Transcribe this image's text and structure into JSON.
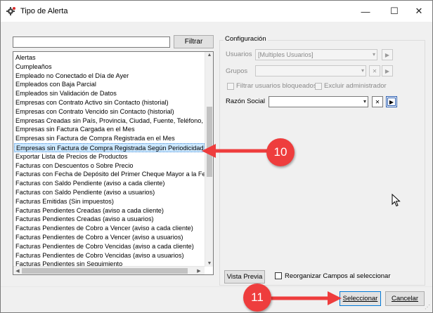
{
  "window": {
    "title": "Tipo de Alerta",
    "minimize_glyph": "—",
    "maximize_glyph": "☐",
    "close_glyph": "✕"
  },
  "filter": {
    "value": "",
    "button_label": "Filtrar"
  },
  "list": {
    "items": [
      "Alertas",
      "Cumpleaños",
      "Empleado no Conectado el Día de Ayer",
      "Empleados con Baja Parcial",
      "Empleados sin Validación de Datos",
      "Empresas con Contrato Activo sin Contacto (historial)",
      "Empresas con Contrato Vencido sin Contacto (historial)",
      "Empresas Creadas sin País, Provincia, Ciudad, Fuente, Teléfono, Tip",
      "Empresas sin Factura Cargada en el Mes",
      "Empresas sin Factura de Compra Registrada en el Mes",
      "Empresas sin Factura de Compra Registrada Según Periodicidad",
      "Exportar Lista de Precios de Productos",
      "Facturas con Descuentos o Sobre Precio",
      "Facturas con Fecha de Depósito del Primer Cheque Mayor a la Fecha",
      "Facturas con Saldo Pendiente (aviso a cada cliente)",
      "Facturas con Saldo Pendiente (aviso a usuarios)",
      "Facturas Emitidas (Sin impuestos)",
      "Facturas Pendientes Creadas (aviso a cada cliente)",
      "Facturas Pendientes Creadas (aviso a usuarios)",
      "Facturas Pendientes de Cobro a Vencer (aviso a cada cliente)",
      "Facturas Pendientes de Cobro a Vencer (aviso a usuarios)",
      "Facturas Pendientes de Cobro Vencidas (aviso a cada cliente)",
      "Facturas Pendientes de Cobro Vencidas (aviso a usuarios)",
      "Facturas Pendientes sin Seguimiento"
    ],
    "selected_index": 10
  },
  "config": {
    "legend": "Configuración",
    "usuarios_label": "Usuarios",
    "usuarios_value": "[Multiples Usuarios]",
    "grupos_label": "Grupos",
    "grupos_value": "",
    "filtrar_bloqueados_label": "Filtrar usuarios bloqueados",
    "excluir_admin_label": "Excluir administrador",
    "razon_social_label": "Razón Social",
    "razon_social_value": ""
  },
  "bottom": {
    "vista_previa_label": "Vista Previa",
    "reorganizar_label": "Reorganizar Campos al seleccionar",
    "seleccionar_label": "Seleccionar",
    "cancelar_label": "Cancelar"
  },
  "callouts": {
    "first": "10",
    "second": "11"
  },
  "colors": {
    "callout_red": "#ee3d3d",
    "selection_blue": "#cce8ff"
  }
}
